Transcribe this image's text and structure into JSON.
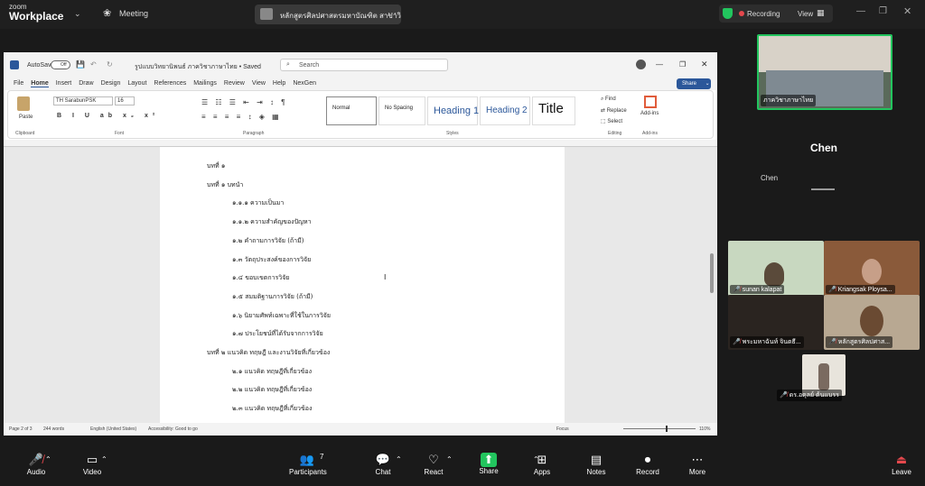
{
  "zoom": {
    "brand_small": "zoom",
    "brand_large": "Workplace",
    "meeting_label": "Meeting",
    "share_tab_title": "หลักสูตรศิลปศาสตรมหาบัณฑิต สาขาวิ",
    "recording_label": "Recording",
    "view_label": "View",
    "active_speaker_name": "Chen",
    "active_speaker_label": "Chen",
    "participant_count": "7"
  },
  "word": {
    "autosave_label": "AutoSave",
    "autosave_state": "Off",
    "doc_title": "รูปแบบวิทยานิพนธ์ ภาควิชาภาษาไทย • Saved",
    "search_placeholder": "Search",
    "menu": [
      "File",
      "Home",
      "Insert",
      "Draw",
      "Design",
      "Layout",
      "References",
      "Mailings",
      "Review",
      "View",
      "Help",
      "NexGen"
    ],
    "share_label": "Share",
    "font_name": "TH SarabunPSK",
    "font_size": "16",
    "paste_label": "Paste",
    "groups": {
      "clipboard": "Clipboard",
      "font": "Font",
      "paragraph": "Paragraph",
      "styles": "Styles",
      "editing": "Editing",
      "addins": "Add-ins"
    },
    "styles": [
      "Normal",
      "No Spacing",
      "Heading 1",
      "Heading 2",
      "Title"
    ],
    "editing": [
      "Find",
      "Replace",
      "Select"
    ],
    "addins_label": "Add-ins",
    "status": {
      "page": "Page 2 of 3",
      "words": "244 words",
      "language": "English (United States)",
      "accessibility": "Accessibility: Good to go",
      "focus": "Focus",
      "zoom": "110%"
    }
  },
  "document_lines": [
    "บทที่ ๑",
    "บทที่ ๑  บทนำ",
    "๑.๑.๑ ความเป็นมา",
    "๑.๑.๒ ความสำคัญของปัญหา",
    "๑.๒ คำถามการวิจัย (ถ้ามี)",
    "๑.๓ วัตถุประสงค์ของการวิจัย",
    "๑.๔ ขอบเขตการวิจัย",
    "๑.๕ สมมติฐานการวิจัย (ถ้ามี)",
    "๑.๖ นิยามศัพท์เฉพาะที่ใช้ในการวิจัย",
    "๑.๗ ประโยชน์ที่ได้รับจากการวิจัย",
    "บทที่ ๒  แนวคิด ทฤษฎี และงานวิจัยที่เกี่ยวข้อง",
    "๒.๑ แนวคิด ทฤษฎีที่เกี่ยวข้อง",
    "๒.๒ แนวคิด ทฤษฎีที่เกี่ยวข้อง",
    "๒.๓ แนวคิด ทฤษฎีที่เกี่ยวข้อง"
  ],
  "participants": [
    {
      "name": "ภาควิชาภาษาไทย"
    },
    {
      "name": "sunan kalapat"
    },
    {
      "name": "Kriangsak Ploysa..."
    },
    {
      "name": "พระมหาฉันท์ จินตธี..."
    },
    {
      "name": "หลักสูตรศิลปศาส..."
    },
    {
      "name": "ดร.อดุลย์ ต้นแบรร"
    }
  ],
  "toolbar": [
    "Audio",
    "Video",
    "Participants",
    "Chat",
    "React",
    "Share",
    "Apps",
    "Notes",
    "Record",
    "More",
    "Leave"
  ],
  "colors": {
    "accent": "#2b579a",
    "record_red": "#e5484d",
    "share_green": "#22c55e",
    "active_border": "#22c55e"
  }
}
